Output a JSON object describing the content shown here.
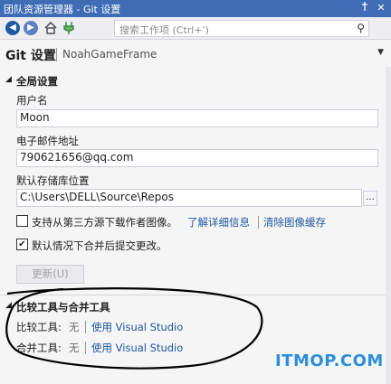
{
  "window": {
    "title": "团队资源管理器 - Git 设置",
    "pin_icon": "pin-icon",
    "close_icon": "close-icon"
  },
  "toolbar": {
    "icons": [
      "back-icon",
      "forward-icon",
      "home-icon",
      "connect-icon"
    ],
    "search_placeholder": "搜索工作项 (Ctrl+')"
  },
  "page": {
    "title": "Git 设置",
    "repo": "NoahGameFrame"
  },
  "global": {
    "header": "全局设置",
    "username_label": "用户名",
    "username_value": "Moon",
    "email_label": "电子邮件地址",
    "email_value": "790621656@qq.com",
    "repo_path_label": "默认存储库位置",
    "repo_path_value": "C:\\Users\\DELL\\Source\\Repos",
    "browse_label": "...",
    "avatar_checkbox": {
      "label": "支持从第三方源下载作者图像。",
      "checked": false,
      "link1": "了解详细信息",
      "link2": "清除图像缓存"
    },
    "merge_checkbox": {
      "label": "默认情况下合并后提交更改。",
      "checked": true
    },
    "update_button": "更新(U)"
  },
  "diff_tools": {
    "header": "比较工具与合并工具",
    "diff_label": "比较工具:",
    "diff_value": "无",
    "diff_link": "使用 Visual Studio",
    "merge_label": "合并工具:",
    "merge_value": "无",
    "merge_link": "使用 Visual Studio"
  },
  "watermark": "ITMOP.COM"
}
